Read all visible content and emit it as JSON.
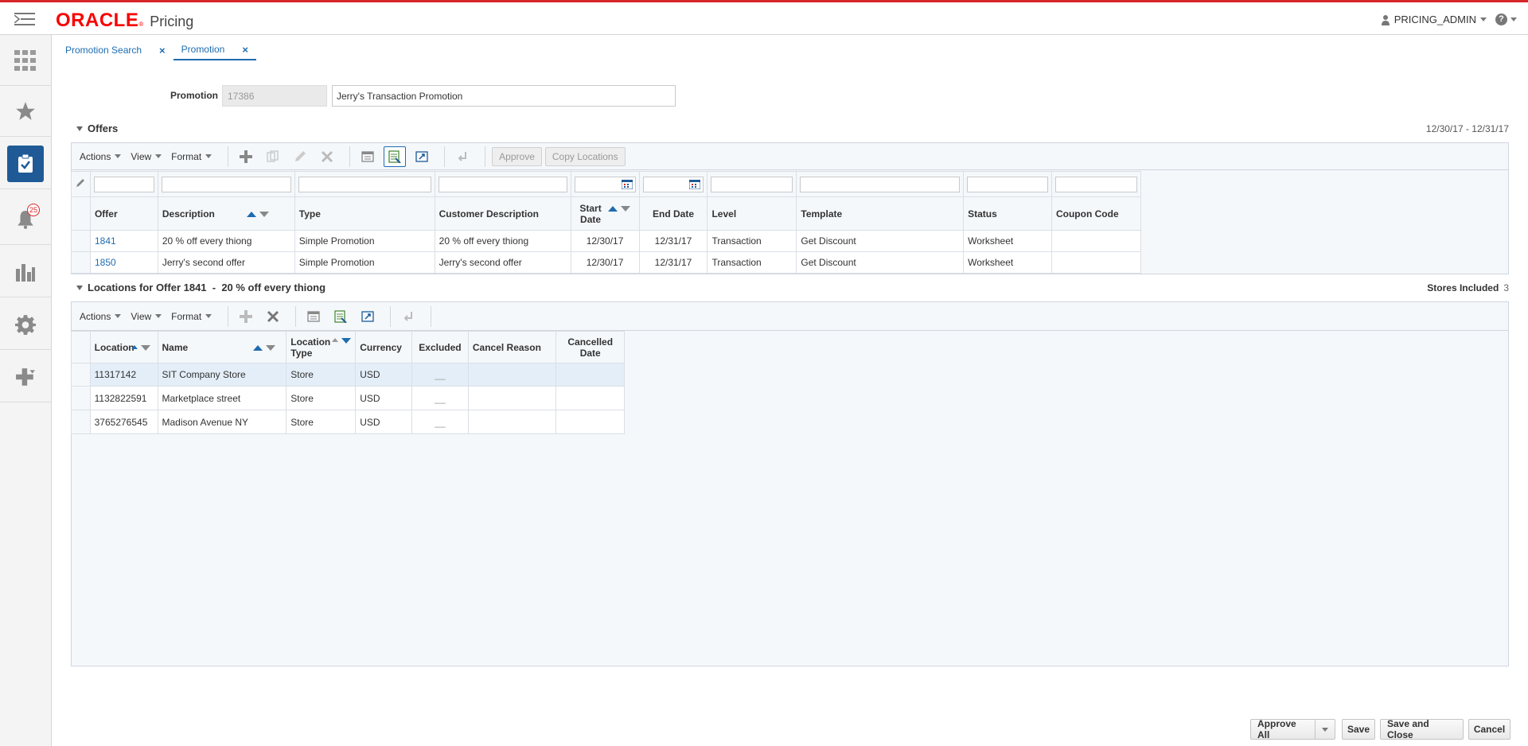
{
  "header": {
    "brand": "ORACLE",
    "app_name": "Pricing",
    "user": "PRICING_ADMIN",
    "help": "?"
  },
  "rail": {
    "items": [
      "menu-grid",
      "favorites",
      "tasks",
      "notifications",
      "reports",
      "settings",
      "add"
    ],
    "notification_count": "25"
  },
  "tabs": [
    {
      "label": "Promotion Search",
      "close": "×"
    },
    {
      "label": "Promotion",
      "close": "×"
    }
  ],
  "promotion": {
    "label": "Promotion",
    "id": "17386",
    "name": "Jerry's Transaction Promotion"
  },
  "offers": {
    "title": "Offers",
    "date_range": "12/30/17 - 12/31/17",
    "toolbar": {
      "actions": "Actions",
      "view": "View",
      "format": "Format",
      "approve": "Approve",
      "copy_locations": "Copy Locations"
    },
    "columns": {
      "offer": "Offer",
      "description": "Description",
      "type": "Type",
      "customer_description": "Customer Description",
      "start_date_1": "Start",
      "start_date_2": "Date",
      "end_date": "End Date",
      "level": "Level",
      "template": "Template",
      "status": "Status",
      "coupon_code": "Coupon Code"
    },
    "rows": [
      {
        "offer": "1841",
        "description": "20 % off every thiong",
        "type": "Simple Promotion",
        "customer_description": "20 % off every thiong",
        "start": "12/30/17",
        "end": "12/31/17",
        "level": "Transaction",
        "template": "Get Discount",
        "status": "Worksheet",
        "coupon": ""
      },
      {
        "offer": "1850",
        "description": "Jerry's second offer",
        "type": "Simple Promotion",
        "customer_description": "Jerry's second offer",
        "start": "12/30/17",
        "end": "12/31/17",
        "level": "Transaction",
        "template": "Get Discount",
        "status": "Worksheet",
        "coupon": ""
      }
    ]
  },
  "locations": {
    "title": "Locations for Offer 1841  -  20 % off every thiong",
    "stores_included_label": "Stores Included",
    "stores_included_count": "3",
    "toolbar": {
      "actions": "Actions",
      "view": "View",
      "format": "Format"
    },
    "columns": {
      "location": "Location",
      "name": "Name",
      "location_type_1": "Location",
      "location_type_2": "Type",
      "currency": "Currency",
      "excluded": "Excluded",
      "cancel_reason": "Cancel Reason",
      "cancelled_date_1": "Cancelled",
      "cancelled_date_2": "Date"
    },
    "rows": [
      {
        "location": "11317142",
        "name": "SIT Company Store",
        "type": "Store",
        "currency": "USD",
        "excluded": "__",
        "cancel_reason": "",
        "cancelled_date": ""
      },
      {
        "location": "1132822591",
        "name": "Marketplace street",
        "type": "Store",
        "currency": "USD",
        "excluded": "__",
        "cancel_reason": "",
        "cancelled_date": ""
      },
      {
        "location": "3765276545",
        "name": "Madison Avenue NY",
        "type": "Store",
        "currency": "USD",
        "excluded": "__",
        "cancel_reason": "",
        "cancelled_date": ""
      }
    ]
  },
  "footer": {
    "approve_all": "Approve All",
    "save": "Save",
    "save_and_close": "Save and Close",
    "cancel": "Cancel"
  },
  "colors": {
    "brand_red": "#f80000",
    "accent_blue": "#1f6cb0",
    "rail_active": "#1f5a96"
  }
}
